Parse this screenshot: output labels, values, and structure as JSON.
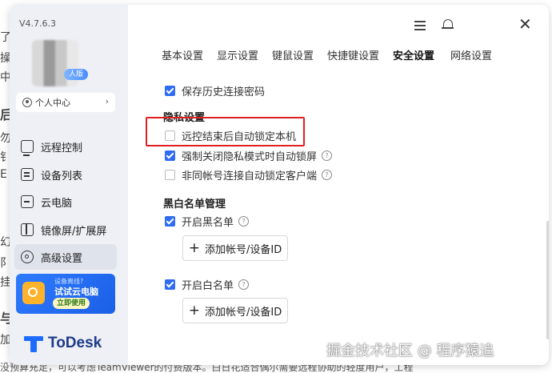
{
  "background": {
    "left_chars": [
      "了",
      "操",
      "中",
      "后",
      "勿",
      "钅",
      "E",
      "幻",
      "阝",
      "挂",
      "与",
      "加"
    ],
    "bottom_text": "没预算充足，可以考虑TeamViewer的付费版本。白日花适合偶尔需要远程协助的轻度用户，工程"
  },
  "window": {
    "version": "V4.7.6.3",
    "vip_badge": "人版",
    "personal_center": "个人中心",
    "nav": [
      {
        "label": "远程控制",
        "icon": "monitor-icon"
      },
      {
        "label": "设备列表",
        "icon": "device-list-icon"
      },
      {
        "label": "云电脑",
        "icon": "cloud-pc-icon"
      },
      {
        "label": "镜像屏/扩展屏",
        "icon": "mirror-screen-icon"
      },
      {
        "label": "高级设置",
        "icon": "advanced-settings-icon",
        "active": true
      }
    ],
    "promo": {
      "small": "设备离线?",
      "title": "试试云电脑",
      "button": "立即使用"
    },
    "logo_text": "ToDesk"
  },
  "tabs": [
    "基本设置",
    "显示设置",
    "键鼠设置",
    "快捷键设置",
    "安全设置",
    "网络设置"
  ],
  "active_tab": "安全设置",
  "settings": {
    "save_history_password": {
      "label": "保存历史连接密码",
      "checked": true
    },
    "privacy_title": "隐私设置",
    "auto_lock": {
      "label": "远控结束后自动锁定本机",
      "checked": false
    },
    "force_close_privacy": {
      "label": "强制关闭隐私模式时自动锁屏",
      "checked": true
    },
    "non_same_account_lock": {
      "label": "非同帐号连接自动锁定客户端",
      "checked": false
    },
    "blackwhite_title": "黑白名单管理",
    "enable_blacklist": {
      "label": "开启黑名单",
      "checked": true
    },
    "add_account_button": "添加帐号/设备ID",
    "enable_whitelist": {
      "label": "开启白名单",
      "checked": true
    },
    "add_account_button_2": "添加帐号/设备ID"
  },
  "watermark": "掘金技术社区 @ 程序猿追",
  "colors": {
    "accent": "#2f6cf0",
    "highlight": "#e02020",
    "sidebar_bg": "#eef0f5"
  }
}
